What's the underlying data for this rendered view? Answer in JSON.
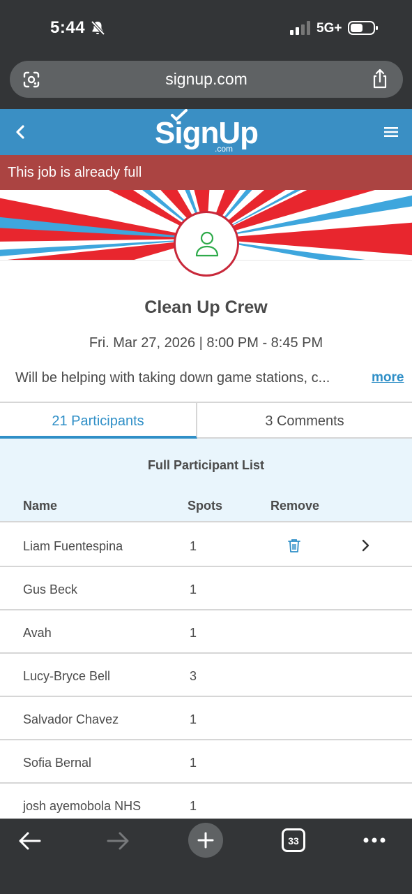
{
  "status_bar": {
    "time": "5:44",
    "network": "5G+",
    "icons": [
      "bell-slash-icon",
      "signal-icon",
      "battery-icon"
    ]
  },
  "browser": {
    "url": "signup.com",
    "tab_count": "33",
    "icons": [
      "lens-icon",
      "share-icon",
      "back-arrow-icon",
      "forward-arrow-icon",
      "plus-icon",
      "more-dots-icon"
    ]
  },
  "header": {
    "logo_text": "SignUp",
    "logo_sub": ".com",
    "icons": [
      "back-chevron-icon",
      "hamburger-menu-icon"
    ],
    "color": "#3a8fc4"
  },
  "alert": {
    "text": "This job is already full",
    "color": "#ab4442"
  },
  "event": {
    "title": "Clean Up Crew",
    "date": "Fri. Mar 27, 2026 | 8:00 PM - 8:45 PM",
    "description": "Will be helping with taking down game stations, c...",
    "more_label": "more"
  },
  "tabs": [
    {
      "label": "21 Participants",
      "active": true
    },
    {
      "label": "3 Comments",
      "active": false
    }
  ],
  "participant_list": {
    "title": "Full Participant List",
    "columns": [
      "Name",
      "Spots",
      "Remove"
    ],
    "rows": [
      {
        "name": "Liam Fuentespina",
        "spots": "1",
        "removable": true
      },
      {
        "name": "Gus Beck",
        "spots": "1",
        "removable": false
      },
      {
        "name": "Avah",
        "spots": "1",
        "removable": false
      },
      {
        "name": "Lucy-Bryce Bell",
        "spots": "3",
        "removable": false
      },
      {
        "name": "Salvador Chavez",
        "spots": "1",
        "removable": false
      },
      {
        "name": "Sofia Bernal",
        "spots": "1",
        "removable": false
      },
      {
        "name": "josh ayemobola NHS",
        "spots": "1",
        "removable": false
      }
    ]
  },
  "accent_color": "#2f8fc7"
}
